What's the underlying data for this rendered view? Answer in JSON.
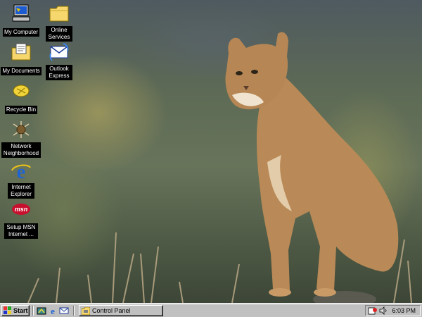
{
  "desktop": {
    "icons": [
      {
        "label": "My Computer",
        "icon": "my-computer-icon"
      },
      {
        "label": "Online Services",
        "icon": "folder-icon"
      },
      {
        "label": "My Documents",
        "icon": "my-documents-icon"
      },
      {
        "label": "Outlook Express",
        "icon": "outlook-express-icon"
      },
      {
        "label": "Recycle Bin",
        "icon": "recycle-bin-icon"
      },
      {
        "label": "Network Neighborhood",
        "icon": "network-neighborhood-icon"
      },
      {
        "label": "Internet Explorer",
        "icon": "internet-explorer-icon"
      },
      {
        "label": "Setup MSN Internet ...",
        "icon": "msn-icon"
      }
    ],
    "wallpaper": "cougar-photo"
  },
  "taskbar": {
    "start_label": "Start",
    "quick_launch": [
      "show-desktop-icon",
      "internet-explorer-icon",
      "outlook-express-icon"
    ],
    "tasks": [
      {
        "label": "Control Panel",
        "icon": "control-panel-icon"
      }
    ],
    "tray": {
      "clock": "6:03 PM",
      "icons": [
        "scheduler-icon",
        "volume-icon"
      ]
    }
  },
  "colors": {
    "taskbar": "#c0c0c0",
    "label_bg": "#000000",
    "label_text": "#ffffff"
  }
}
